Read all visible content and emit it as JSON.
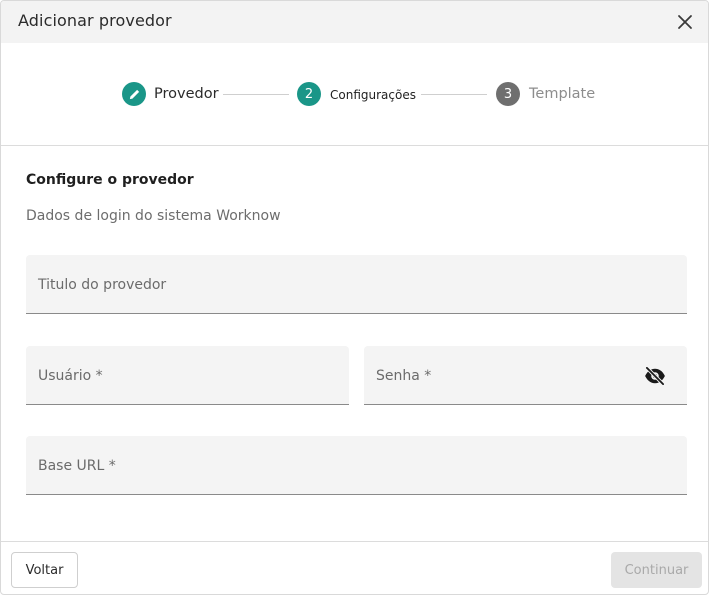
{
  "dialog": {
    "title": "Adicionar provedor"
  },
  "stepper": {
    "steps": [
      {
        "label": "Provedor",
        "number": "",
        "status": "completed"
      },
      {
        "label": "Configurações",
        "number": "2",
        "status": "active"
      },
      {
        "label": "Template",
        "number": "3",
        "status": "pending"
      }
    ]
  },
  "form": {
    "title": "Configure o provedor",
    "subtitle": "Dados de login do sistema Worknow",
    "fields": {
      "provider_title": "Titulo do provedor",
      "username": "Usuário *",
      "password": "Senha *",
      "base_url": "Base URL *"
    }
  },
  "footer": {
    "back_label": "Voltar",
    "continue_label": "Continuar"
  },
  "colors": {
    "accent": "#1a9688",
    "pending": "#6f6f6f"
  },
  "icons": {
    "close": "close-icon",
    "completed_step": "pencil-icon",
    "password_toggle": "eye-off-icon"
  }
}
